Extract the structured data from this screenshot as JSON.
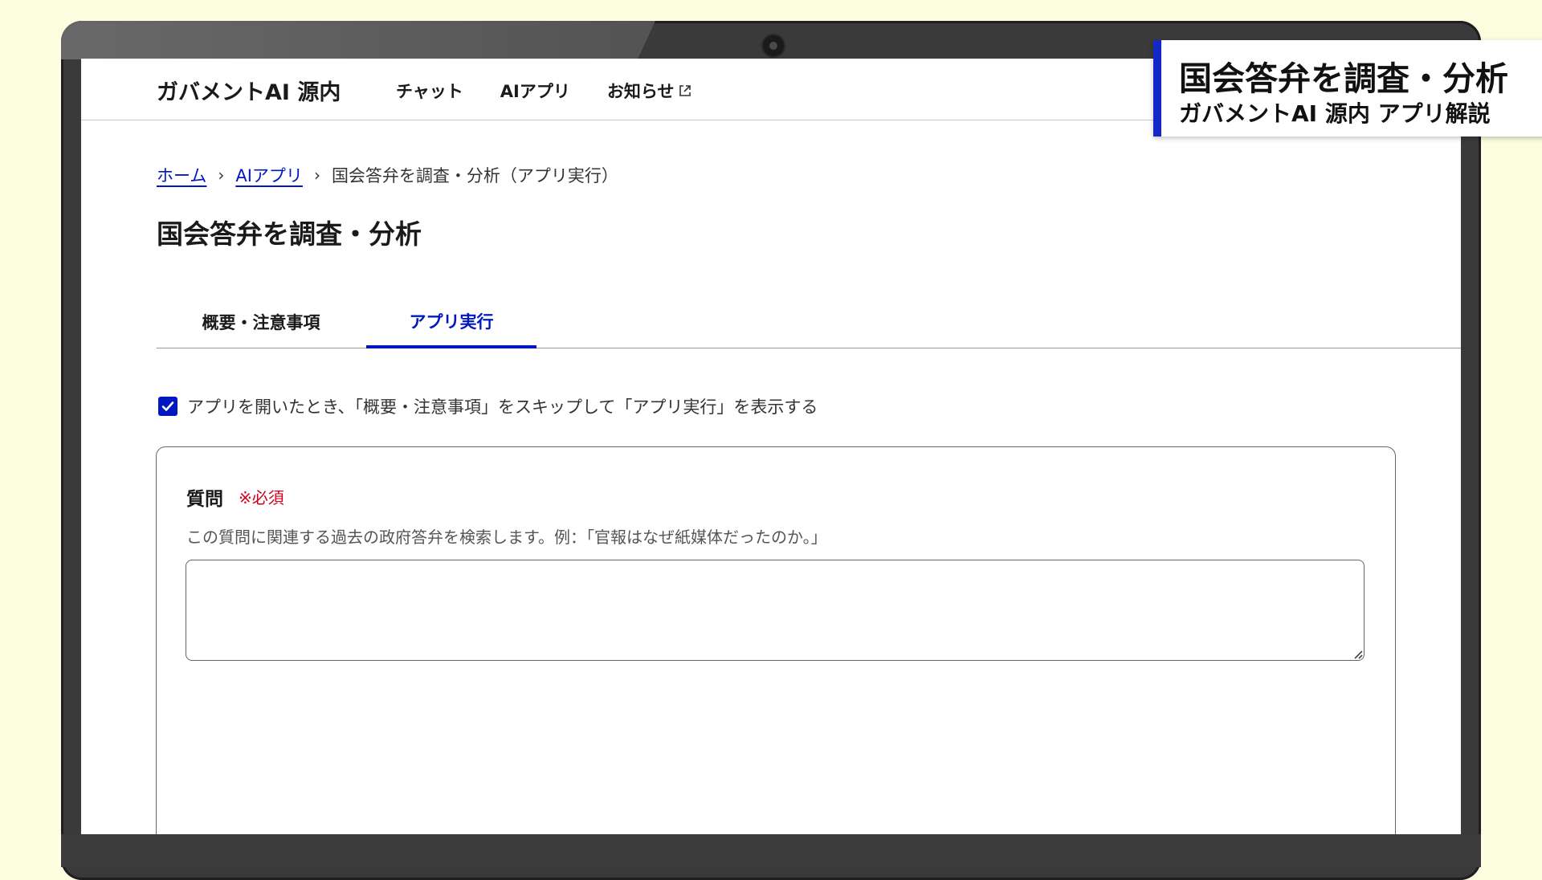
{
  "header": {
    "brand": "ガバメントAI 源内",
    "nav": [
      "チャット",
      "AIアプリ",
      "お知らせ"
    ]
  },
  "breadcrumb": {
    "home": "ホーム",
    "apps": "AIアプリ",
    "current": "国会答弁を調査・分析（アプリ実行）"
  },
  "page": {
    "title": "国会答弁を調査・分析"
  },
  "tabs": {
    "overview": "概要・注意事項",
    "run": "アプリ実行",
    "active": "run"
  },
  "skip_option": {
    "label": "アプリを開いたとき、「概要・注意事項」をスキップして「アプリ実行」を表示する",
    "checked": true
  },
  "form": {
    "question_label": "質問",
    "required_mark": "※必須",
    "question_help": "この質問に関連する過去の政府答弁を検索します。例：「官報はなぜ紙媒体だったのか。」",
    "question_value": ""
  },
  "caption": {
    "main": "国会答弁を調査・分析",
    "sub": "ガバメントAI 源内 アプリ解説"
  },
  "colors": {
    "accent": "#0017c1",
    "required": "#d0021b",
    "background": "#fdfde0"
  },
  "icons": {
    "external_link": "external-link-icon",
    "chevron": "chevron-right-icon",
    "check": "check-icon",
    "resize": "resize-handle-icon"
  }
}
